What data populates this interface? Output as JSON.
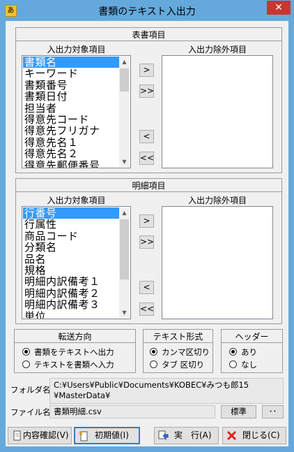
{
  "window": {
    "title": "書類のテキスト入出力",
    "app_icon": "app-icon",
    "close_glyph": "✕"
  },
  "header_section": {
    "title": "表書項目",
    "included_label": "入出力対象項目",
    "excluded_label": "入出力除外項目",
    "included_items": [
      "書類名",
      "キーワード",
      "書類番号",
      "書類日付",
      "担当者",
      "得意先コード",
      "得意先フリガナ",
      "得意先名１",
      "得意先名２",
      "得意先郵便番号"
    ],
    "excluded_items": []
  },
  "detail_section": {
    "title": "明細項目",
    "included_label": "入出力対象項目",
    "excluded_label": "入出力除外項目",
    "included_items": [
      "行番号",
      "行属性",
      "商品コード",
      "分類名",
      "品名",
      "規格",
      "明細内訳備考１",
      "明細内訳備考２",
      "明細内訳備考３",
      "単位"
    ],
    "excluded_items": []
  },
  "move_buttons": {
    "add": ">",
    "add_all": ">>",
    "remove": "<",
    "remove_all": "<<"
  },
  "direction": {
    "title": "転送方向",
    "options": [
      "書類をテキストへ出力",
      "テキストを書類へ入力"
    ],
    "selected": 0
  },
  "text_format": {
    "title": "テキスト形式",
    "options": [
      "カンマ区切り",
      "タブ 区切り"
    ],
    "selected": 0
  },
  "header": {
    "title": "ヘッダー",
    "options": [
      "あり",
      "なし"
    ],
    "selected": 0
  },
  "folder": {
    "label": "フォルダ名:",
    "line1": "C:¥Users¥Public¥Documents¥KOBEC¥みつも郎15",
    "line2": "¥MasterData¥"
  },
  "file": {
    "label": "ファイル名:",
    "value": "書類明細.csv",
    "standard_button": "標準",
    "browse_button": "･･"
  },
  "buttons": {
    "confirm": "内容確認(V)",
    "initial": "初期値(I)",
    "execute": "実　行(A)",
    "close": "閉じる(C)"
  }
}
